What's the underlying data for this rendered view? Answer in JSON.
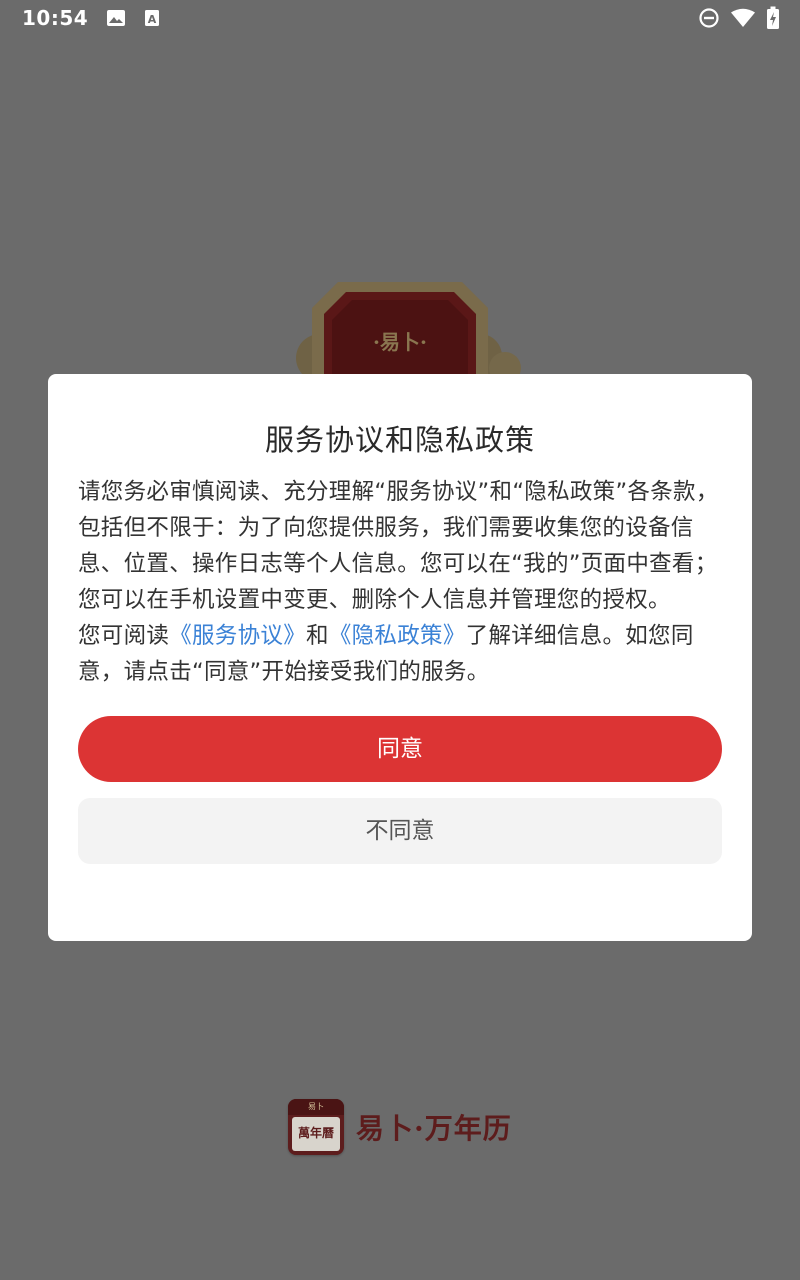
{
  "status_bar": {
    "time": "10:54",
    "left_icons": [
      "image-icon",
      "font-a-icon"
    ],
    "right_icons": [
      "dnd-icon",
      "wifi-icon",
      "battery-charging-icon"
    ]
  },
  "splash": {
    "emblem_text": "·易卜·",
    "footer_logo_top": "易卜",
    "footer_logo_text": "萬年曆",
    "footer_name": "易卜·万年历"
  },
  "dialog": {
    "title": "服务协议和隐私政策",
    "para1": "请您务必审慎阅读、充分理解“服务协议”和“隐私政策”各条款，包括但不限于：为了向您提供服务，我们需要收集您的设备信息、位置、操作日志等个人信息。您可以在“我的”页面中查看；您可以在手机设置中变更、删除个人信息并管理您的授权。",
    "para2_prefix": "您可阅读",
    "service_link": "《服务协议》",
    "para2_and": "和",
    "privacy_link": "《隐私政策》",
    "para2_suffix": "了解详细信息。如您同意，请点击“同意”开始接受我们的服务。",
    "agree_label": "同意",
    "disagree_label": "不同意"
  },
  "colors": {
    "overlay": "#6b6b6b",
    "accent": "#dc3434",
    "link": "#3b82d6",
    "brand": "#5d1c1c"
  }
}
